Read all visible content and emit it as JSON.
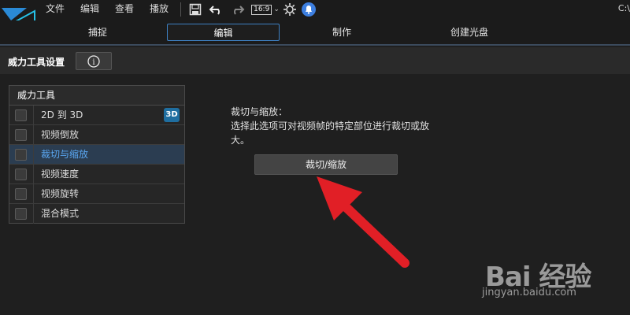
{
  "menu": {
    "items": [
      "文件",
      "编辑",
      "查看",
      "播放"
    ]
  },
  "topbar": {
    "aspect_ratio": "16:9",
    "icons": [
      "save-icon",
      "undo-icon",
      "redo-icon",
      "settings-icon",
      "notification-icon"
    ],
    "right_text": "C:\\"
  },
  "tabs": [
    {
      "label": "捕捉"
    },
    {
      "label": "编辑",
      "active": true
    },
    {
      "label": "制作"
    },
    {
      "label": "创建光盘"
    }
  ],
  "section": {
    "title": "威力工具设置",
    "info_label": "i"
  },
  "toollist": {
    "header": "威力工具",
    "items": [
      {
        "label": "2D 到 3D",
        "badge": "3D"
      },
      {
        "label": "视频倒放"
      },
      {
        "label": "裁切与缩放",
        "selected": true
      },
      {
        "label": "视频速度"
      },
      {
        "label": "视频旋转"
      },
      {
        "label": "混合模式"
      }
    ]
  },
  "description": {
    "title": "裁切与缩放：",
    "text": "选择此选项可对视频帧的特定部位进行裁切或放大。"
  },
  "crop_button": {
    "label": "裁切/缩放"
  },
  "watermark": {
    "big": "Bai 经验",
    "small": "jingyan.baidu.com"
  },
  "colors": {
    "accent": "#3d7fc1",
    "selected_text": "#5aa7f2",
    "arrow": "#e11f26"
  }
}
